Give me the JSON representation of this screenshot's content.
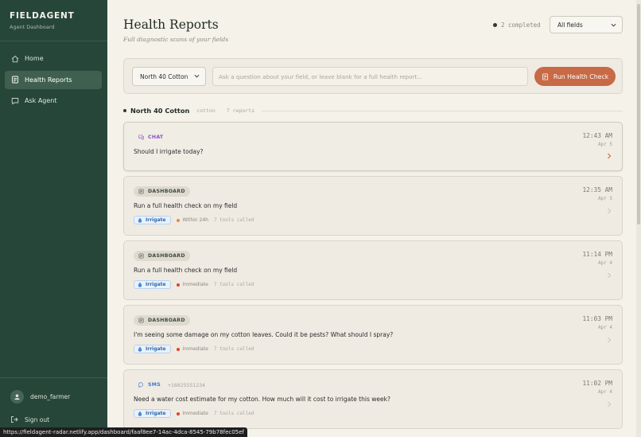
{
  "sidebar": {
    "brand": "FIELDAGENT",
    "subtitle": "Agent Dashboard",
    "nav": [
      {
        "label": "Home",
        "icon": "home-icon",
        "active": false
      },
      {
        "label": "Health Reports",
        "icon": "report-icon",
        "active": true
      },
      {
        "label": "Ask Agent",
        "icon": "chat-icon",
        "active": false
      }
    ],
    "user": "demo_farmer",
    "signout": "Sign out"
  },
  "header": {
    "title": "Health Reports",
    "subtitle": "Full diagnostic scans of your fields",
    "completed": "2 completed",
    "field_filter": "All fields"
  },
  "query": {
    "field": "North 40 Cotton",
    "placeholder": "Ask a question about your field, or leave blank for a full health report...",
    "button": "Run Health Check"
  },
  "group": {
    "name": "North 40 Cotton",
    "crop": "cotton",
    "reports": "7 reports"
  },
  "reports": [
    {
      "channel": "CHAT",
      "phone": "",
      "message": "Should I irrigate today?",
      "time": "12:43 AM",
      "date": "Apr 5",
      "tag": "",
      "urgency": "",
      "tools": ""
    },
    {
      "channel": "DASHBOARD",
      "phone": "",
      "message": "Run a full health check on my field",
      "time": "12:35 AM",
      "date": "Apr 5",
      "tag": "Irrigate",
      "urgency": "Within 24h",
      "tools": "7 tools called"
    },
    {
      "channel": "DASHBOARD",
      "phone": "",
      "message": "Run a full health check on my field",
      "time": "11:14 PM",
      "date": "Apr 4",
      "tag": "Irrigate",
      "urgency": "Immediate",
      "tools": "7 tools called"
    },
    {
      "channel": "DASHBOARD",
      "phone": "",
      "message": "I'm seeing some damage on my cotton leaves. Could it be pests? What should I spray?",
      "time": "11:03 PM",
      "date": "Apr 4",
      "tag": "Irrigate",
      "urgency": "Immediate",
      "tools": "7 tools called"
    },
    {
      "channel": "SMS",
      "phone": "+16025551234",
      "message": "Need a water cost estimate for my cotton. How much will it cost to irrigate this week?",
      "time": "11:02 PM",
      "date": "Apr 4",
      "tag": "Irrigate",
      "urgency": "Immediate",
      "tools": "7 tools called"
    }
  ],
  "colors": {
    "sidebar": "#27463a",
    "accent": "#c76a45",
    "urgency_within": "#e8893a",
    "urgency_immediate": "#d9452f"
  },
  "status_url": "https://fieldagent-radar.netlify.app/dashboard/faaf8ee7-14ac-4dca-8545-79b78fec05ef"
}
